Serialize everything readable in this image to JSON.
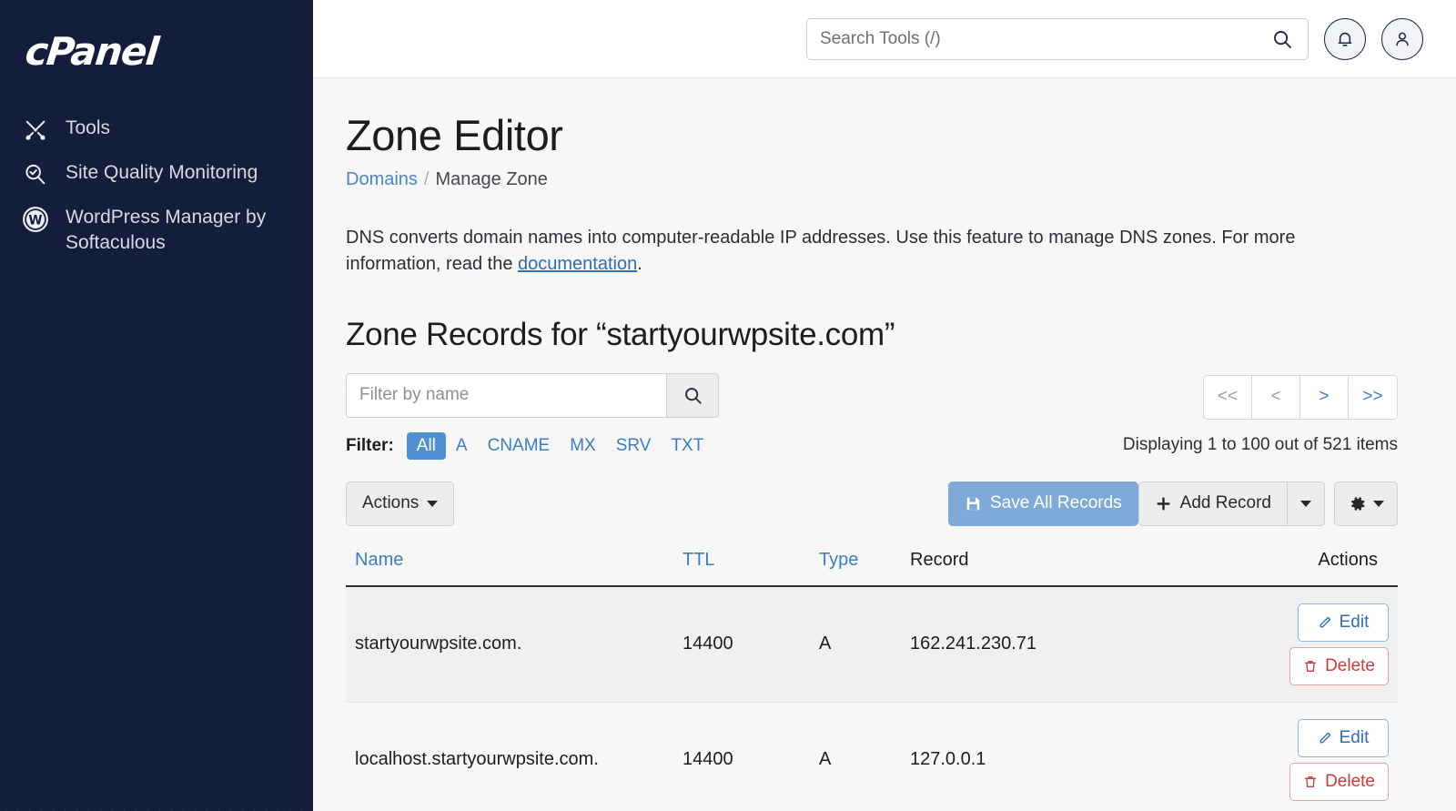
{
  "sidebar": {
    "brand": "cPanel",
    "items": [
      {
        "label": "Tools",
        "icon": "tools-icon"
      },
      {
        "label": "Site Quality Monitoring",
        "icon": "site-quality-icon"
      },
      {
        "label": "WordPress Manager by Softaculous",
        "icon": "wordpress-icon"
      }
    ]
  },
  "header": {
    "search_placeholder": "Search Tools (/)",
    "search_value": "",
    "search_icon": "search-icon",
    "notifications_icon": "bell-icon",
    "account_icon": "user-icon"
  },
  "page": {
    "title": "Zone Editor",
    "breadcrumb": {
      "parent": "Domains",
      "separator": "/",
      "current": "Manage Zone"
    },
    "description_part1": "DNS converts domain names into computer-readable IP addresses. Use this feature to manage DNS zones. For more information, read the ",
    "description_link": "documentation",
    "description_part2": ".",
    "section_title": "Zone Records for “startyourwpsite.com”"
  },
  "filter": {
    "input_placeholder": "Filter by name",
    "input_value": "",
    "search_icon": "search-icon",
    "label": "Filter:",
    "types": [
      {
        "label": "All",
        "active": true
      },
      {
        "label": "A",
        "active": false
      },
      {
        "label": "CNAME",
        "active": false
      },
      {
        "label": "MX",
        "active": false
      },
      {
        "label": "SRV",
        "active": false
      },
      {
        "label": "TXT",
        "active": false
      }
    ]
  },
  "pagination": {
    "first_label": "<<",
    "prev_label": "<",
    "next_label": ">",
    "last_label": ">>",
    "first_disabled": true,
    "prev_disabled": true,
    "status": "Displaying 1 to 100 out of 521 items"
  },
  "toolbar": {
    "actions_label": "Actions",
    "save_all_label": "Save All Records",
    "save_icon": "save-icon",
    "add_record_label": "Add Record",
    "add_icon": "plus-icon",
    "add_caret_icon": "chevron-down-icon",
    "gear_icon": "gear-icon",
    "gear_caret_icon": "chevron-down-icon"
  },
  "table": {
    "columns": [
      {
        "key": "name",
        "label": "Name",
        "sortable": true
      },
      {
        "key": "ttl",
        "label": "TTL",
        "sortable": true
      },
      {
        "key": "type",
        "label": "Type",
        "sortable": true
      },
      {
        "key": "record",
        "label": "Record",
        "sortable": false
      },
      {
        "key": "actions",
        "label": "Actions",
        "sortable": false
      }
    ],
    "row_actions": {
      "edit_label": "Edit",
      "edit_icon": "pencil-icon",
      "delete_label": "Delete",
      "delete_icon": "trash-icon"
    },
    "rows": [
      {
        "name": "startyourwpsite.com.",
        "ttl": "14400",
        "type": "A",
        "record": "162.241.230.71"
      },
      {
        "name": "localhost.startyourwpsite.com.",
        "ttl": "14400",
        "type": "A",
        "record": "127.0.0.1"
      }
    ]
  },
  "colors": {
    "sidebar_bg": "#141e3c",
    "accent_blue": "#4e90d2",
    "link_blue": "#3a7fc1",
    "primary_muted": "#7fa9d8",
    "danger_red": "#cc3b3b",
    "content_bg": "#f7f7f8",
    "stripe_bg": "#f0f0f0"
  }
}
